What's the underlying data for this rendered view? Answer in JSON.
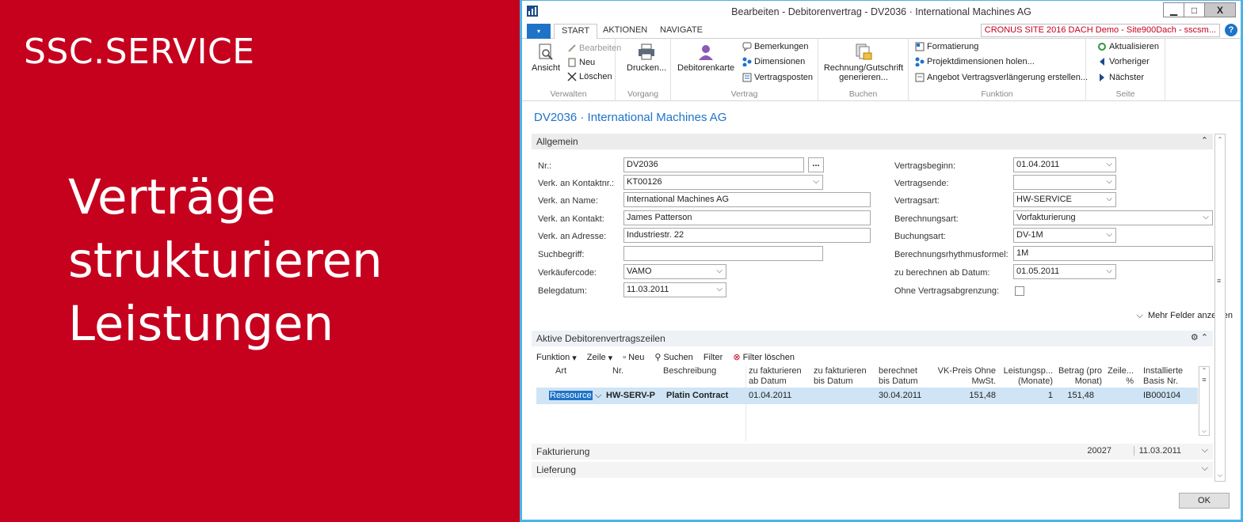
{
  "banner": {
    "brand": "SSC.SERVICE",
    "headline": [
      "Verträge",
      "strukturieren",
      "Leistungen"
    ]
  },
  "window": {
    "title": "Bearbeiten - Debitorenvertrag - DV2036 · International Machines AG",
    "minimize": "▁",
    "restore": "□",
    "close": "X"
  },
  "tabs": {
    "file": "▾",
    "items": [
      "START",
      "AKTIONEN",
      "NAVIGATE"
    ],
    "site": "CRONUS SITE 2016 DACH Demo - Site900Dach - sscsm...",
    "help": "?"
  },
  "ribbon": {
    "verwalten": {
      "label": "Verwalten",
      "ansicht": "Ansicht",
      "bearbeiten": "Bearbeiten",
      "neu": "Neu",
      "loeschen": "Löschen"
    },
    "vorgang": {
      "label": "Vorgang",
      "drucken": "Drucken..."
    },
    "vertrag": {
      "label": "Vertrag",
      "debitorenkarte": "Debitorenkarte",
      "bemerkungen": "Bemerkungen",
      "dimensionen": "Dimensionen",
      "vertragsposten": "Vertragsposten"
    },
    "buchen": {
      "label": "Buchen",
      "rechnung_1": "Rechnung/Gutschrift",
      "rechnung_2": "generieren..."
    },
    "funktion": {
      "label": "Funktion",
      "formatierung": "Formatierung",
      "projektdimensionen": "Projektdimensionen holen...",
      "angebot": "Angebot Vertragsverlängerung erstellen..."
    },
    "seite": {
      "label": "Seite",
      "aktualisieren": "Aktualisieren",
      "vorheriger": "Vorheriger",
      "naechster": "Nächster"
    }
  },
  "page": {
    "title": "DV2036 · International Machines AG"
  },
  "allgemein": {
    "header": "Allgemein",
    "chevron": "⌃",
    "left": [
      {
        "label": "Nr.:",
        "value": "DV2036"
      },
      {
        "label": "Verk. an Kontaktnr.:",
        "value": "KT00126"
      },
      {
        "label": "Verk. an Name:",
        "value": "International Machines AG"
      },
      {
        "label": "Verk. an Kontakt:",
        "value": "James Patterson"
      },
      {
        "label": "Verk. an Adresse:",
        "value": "Industriestr. 22"
      },
      {
        "label": "Suchbegriff:",
        "value": ""
      },
      {
        "label": "Verkäufercode:",
        "value": "VAMO"
      },
      {
        "label": "Belegdatum:",
        "value": "11.03.2011"
      }
    ],
    "right": [
      {
        "label": "Vertragsbeginn:",
        "value": "01.04.2011"
      },
      {
        "label": "Vertragsende:",
        "value": ""
      },
      {
        "label": "Vertragsart:",
        "value": "HW-SERVICE"
      },
      {
        "label": "Berechnungsart:",
        "value": "Vorfakturierung"
      },
      {
        "label": "Buchungsart:",
        "value": "DV-1M"
      },
      {
        "label": "Berechnungsrhythmusformel:",
        "value": "1M"
      },
      {
        "label": "zu berechnen ab Datum:",
        "value": "01.05.2011"
      },
      {
        "label": "Ohne Vertragsabgrenzung:",
        "value": ""
      }
    ],
    "ellipsis": "...",
    "more_fields": "Mehr Felder anzeigen"
  },
  "lines": {
    "header": "Aktive Debitorenvertragszeilen",
    "toolbar": {
      "funktion": "Funktion",
      "zeile": "Zeile",
      "neu": "Neu",
      "suchen": "Suchen",
      "filter": "Filter",
      "filter_loeschen": "Filter löschen"
    },
    "columns": [
      "Art",
      "Nr.",
      "Beschreibung",
      "zu fakturieren ab Datum",
      "zu fakturieren bis Datum",
      "berechnet bis Datum",
      "VK-Preis Ohne MwSt.",
      "Leistungsp... (Monate)",
      "Betrag (pro Monat)",
      "Zeile... %",
      "Installierte Basis Nr."
    ],
    "rows": [
      {
        "art": "Ressource",
        "nr": "HW-SERV-P",
        "beschreibung": "Platin Contract",
        "ab": "01.04.2011",
        "bis": "",
        "berechnet": "30.04.2011",
        "preis": "151,48",
        "monate": "1",
        "betrag": "151,48",
        "zeile": "",
        "basis": "IB000104"
      }
    ]
  },
  "fakturierung": {
    "header": "Fakturierung",
    "value1": "20027",
    "value2": "11.03.2011"
  },
  "lieferung": {
    "header": "Lieferung"
  },
  "ok": "OK"
}
